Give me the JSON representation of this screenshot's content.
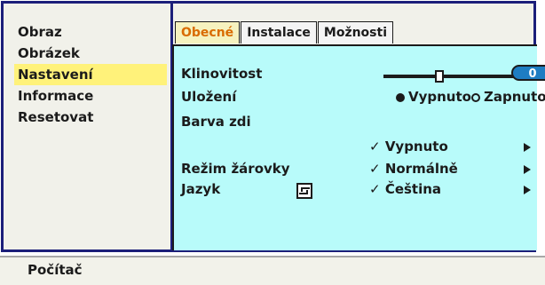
{
  "menu": {
    "items": [
      {
        "label": "Obraz"
      },
      {
        "label": "Obrázek"
      },
      {
        "label": "Nastavení",
        "selected": true
      },
      {
        "label": "Informace"
      },
      {
        "label": "Resetovat"
      }
    ]
  },
  "tabs": [
    {
      "label": "Obecné",
      "active": true
    },
    {
      "label": "Instalace"
    },
    {
      "label": "Možnosti"
    }
  ],
  "settings": {
    "keystone": {
      "label": "Klinovitost",
      "value": "0"
    },
    "save": {
      "label": "Uložení",
      "options": [
        "Vypnuto",
        "Zapnuto"
      ],
      "selected": "Vypnuto"
    },
    "wall_color": {
      "label": "Barva zdi",
      "value": "Vypnuto"
    },
    "lamp_mode": {
      "label": "Režim žárovky",
      "value": "Normálně"
    },
    "language": {
      "label": "Jazyk",
      "value": "Čeština"
    }
  },
  "status": {
    "text": "Počítač"
  },
  "colors": {
    "frame": "#1c1f7a",
    "content_bg": "#b8fbfa",
    "menu_highlight": "#fff27a",
    "active_tab_text": "#d96b00",
    "value_box": "#1e7dc2"
  },
  "icons": {
    "language": "keyboard-layout-icon",
    "submenu": "triangle-right-icon"
  }
}
